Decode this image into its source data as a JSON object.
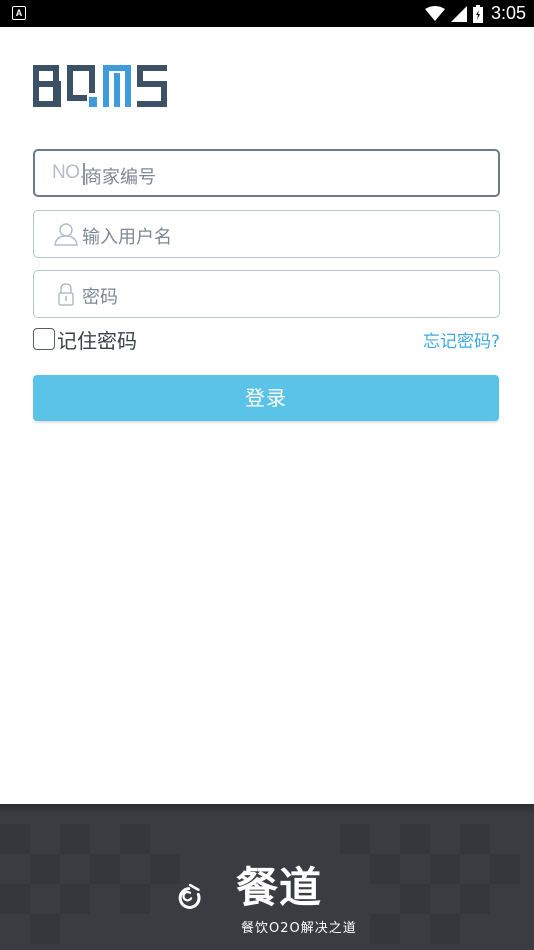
{
  "status_bar": {
    "notification": "A",
    "time": "3:05"
  },
  "logo": {
    "text": "BQMS"
  },
  "form": {
    "merchant_prefix": "NO.",
    "merchant_placeholder": "商家编号",
    "username_placeholder": "输入用户名",
    "password_placeholder": "密码",
    "remember_label": "记住密码",
    "forgot_link": "忘记密码?",
    "login_button": "登录"
  },
  "footer": {
    "brand_name": "餐道",
    "slogan": "餐饮O2O解决之道"
  },
  "colors": {
    "accent": "#5bc3e8",
    "link": "#3fa9e0",
    "logo_dark": "#3d5166",
    "logo_blue": "#3f9bdc",
    "footer_bg": "#3a3c41"
  }
}
